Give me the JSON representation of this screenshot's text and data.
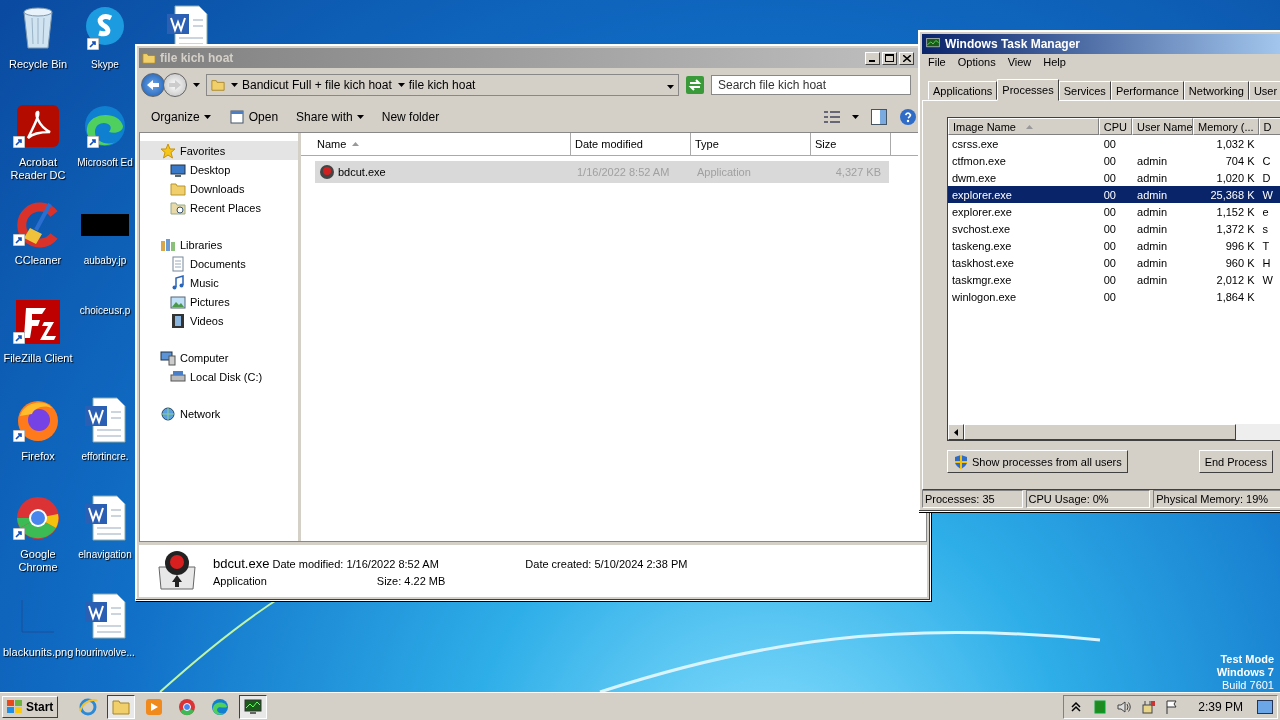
{
  "desktop": {
    "icon_columns": [
      [
        {
          "kind": "recycle",
          "label": "Recycle Bin",
          "shortcut": false
        },
        {
          "kind": "acrobat",
          "label": "Acrobat Reader DC",
          "shortcut": true
        },
        {
          "kind": "ccleaner",
          "label": "CCleaner",
          "shortcut": true
        },
        {
          "kind": "filezilla",
          "label": "FileZilla Client",
          "shortcut": true
        },
        {
          "kind": "firefox",
          "label": "Firefox",
          "shortcut": true
        },
        {
          "kind": "chrome",
          "label": "Google Chrome",
          "shortcut": true
        },
        {
          "kind": "blank",
          "label": "blackunits.png",
          "shortcut": false
        }
      ],
      [
        {
          "kind": "skype",
          "label": "Skype",
          "shortcut": true
        },
        {
          "kind": "edge",
          "label": "Microsoft Ed",
          "shortcut": true
        },
        {
          "kind": "black",
          "label": "aubaby.jp",
          "shortcut": false
        },
        {
          "kind": "none",
          "label": "choiceusr.p",
          "shortcut": false
        },
        {
          "kind": "word",
          "label": "effortincre.",
          "shortcut": false
        },
        {
          "kind": "word",
          "label": "elnavigation",
          "shortcut": false
        },
        {
          "kind": "word",
          "label": "hourinvolve...",
          "shortcut": false
        }
      ],
      [
        {
          "kind": "word",
          "shortcut": false
        }
      ]
    ],
    "test_mode": [
      "Test Mode",
      "Windows 7",
      "Build 7601"
    ]
  },
  "explorer": {
    "title": "file kich hoat",
    "breadcrumb": [
      "Bandicut Full + file kich hoat",
      "file kich hoat"
    ],
    "search": {
      "placeholder": "Search file kich hoat"
    },
    "toolbar": [
      {
        "kind": "menu",
        "label": "Organize"
      },
      {
        "kind": "open",
        "label": "Open"
      },
      {
        "kind": "menu",
        "label": "Share with"
      },
      {
        "kind": "plain",
        "label": "New folder"
      }
    ],
    "nav": [
      {
        "kind": "star",
        "label": "Favorites",
        "selected": true,
        "children": [
          {
            "kind": "desktop",
            "label": "Desktop",
            "selected": false
          },
          {
            "kind": "folder",
            "label": "Downloads",
            "selected": false
          },
          {
            "kind": "recent",
            "label": "Recent Places",
            "selected": false
          }
        ]
      },
      {
        "kind": "library",
        "label": "Libraries",
        "selected": false,
        "children": [
          {
            "kind": "docs",
            "label": "Documents",
            "selected": false
          },
          {
            "kind": "music",
            "label": "Music",
            "selected": false
          },
          {
            "kind": "pictures",
            "label": "Pictures",
            "selected": false
          },
          {
            "kind": "videos",
            "label": "Videos",
            "selected": false
          }
        ]
      },
      {
        "kind": "computer",
        "label": "Computer",
        "selected": false,
        "children": [
          {
            "kind": "disk",
            "label": "Local Disk (C:)",
            "selected": false
          }
        ]
      },
      {
        "kind": "network",
        "label": "Network",
        "selected": false
      }
    ],
    "columns": [
      "Name",
      "Date modified",
      "Type",
      "Size"
    ],
    "files": [
      {
        "name": "bdcut.exe",
        "date": "1/16/2022 8:52 AM",
        "type": "Application",
        "size": "4,327 KB",
        "selected": true
      }
    ],
    "details": {
      "name": "bdcut.exe",
      "type": "Application",
      "fields": [
        {
          "label": "Date modified:",
          "value": "1/16/2022 8:52 AM"
        },
        {
          "label": "Size:",
          "value": "4.22 MB"
        },
        {
          "label": "Date created:",
          "value": "5/10/2024 2:38 PM"
        }
      ]
    }
  },
  "task_manager": {
    "title": "Windows Task Manager",
    "menu": [
      "File",
      "Options",
      "View",
      "Help"
    ],
    "tabs": [
      {
        "label": "Applications",
        "selected": false
      },
      {
        "label": "Processes",
        "selected": true
      },
      {
        "label": "Services",
        "selected": false
      },
      {
        "label": "Performance",
        "selected": false
      },
      {
        "label": "Networking",
        "selected": false
      },
      {
        "label": "User",
        "selected": false
      }
    ],
    "columns": [
      "Image Name",
      "CPU",
      "User Name",
      "Memory (...",
      "D"
    ],
    "rows": [
      {
        "name": "csrss.exe",
        "cpu": "00",
        "memory": "1,032 K",
        "selected": false
      },
      {
        "name": "ctfmon.exe",
        "cpu": "00",
        "user": "admin",
        "memory": "704 K",
        "column_5": "C",
        "selected": false
      },
      {
        "name": "dwm.exe",
        "cpu": "00",
        "user": "admin",
        "memory": "1,020 K",
        "column_5": "D",
        "selected": false
      },
      {
        "name": "explorer.exe",
        "cpu": "00",
        "user": "admin",
        "memory": "25,368 K",
        "column_5": "W",
        "selected": true
      },
      {
        "name": "explorer.exe",
        "cpu": "00",
        "user": "admin",
        "memory": "1,152 K",
        "column_5": "e",
        "selected": false
      },
      {
        "name": "svchost.exe",
        "cpu": "00",
        "user": "admin",
        "memory": "1,372 K",
        "column_5": "s",
        "selected": false
      },
      {
        "name": "taskeng.exe",
        "cpu": "00",
        "user": "admin",
        "memory": "996 K",
        "column_5": "T",
        "selected": false
      },
      {
        "name": "taskhost.exe",
        "cpu": "00",
        "user": "admin",
        "memory": "960 K",
        "column_5": "H",
        "selected": false
      },
      {
        "name": "taskmgr.exe",
        "cpu": "00",
        "user": "admin",
        "memory": "2,012 K",
        "column_5": "W",
        "selected": false
      },
      {
        "name": "winlogon.exe",
        "cpu": "00",
        "memory": "1,864 K",
        "selected": false
      }
    ],
    "buttons": [
      "Show processes from all users",
      "End Process"
    ],
    "status": [
      "Processes: 35",
      "CPU Usage: 0%",
      "Physical Memory: 19%"
    ]
  },
  "taskbar": {
    "start": "Start",
    "apps": [
      {
        "kind": "ie",
        "active": false
      },
      {
        "kind": "folder",
        "active": true
      },
      {
        "kind": "media",
        "active": false
      },
      {
        "kind": "chrome",
        "active": false
      },
      {
        "kind": "edge",
        "active": false
      },
      {
        "kind": "taskmgr",
        "active": true
      }
    ],
    "time": "2:39 PM"
  }
}
